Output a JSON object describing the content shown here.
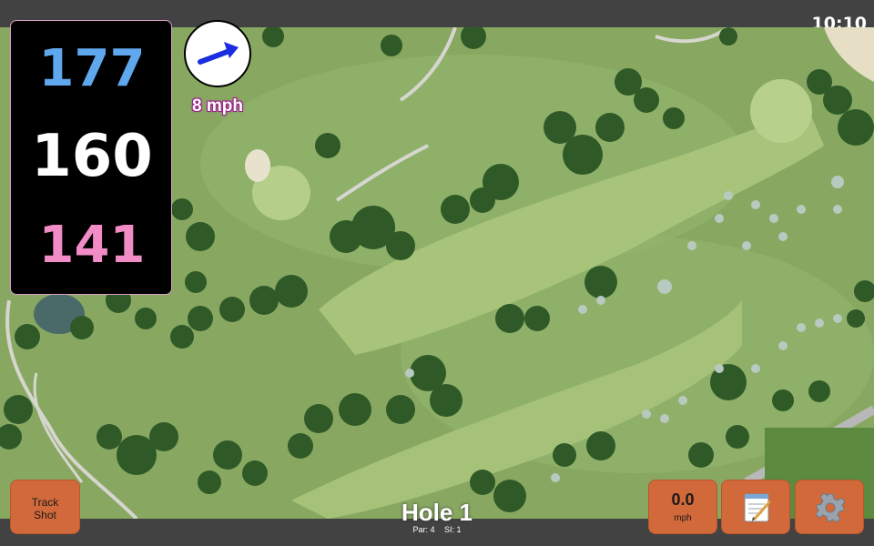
{
  "status": {
    "time": "10:10"
  },
  "distances": {
    "back": "177",
    "center": "160",
    "front": "141"
  },
  "wind": {
    "speed_label": "8 mph",
    "direction_icon": "arrow-icon"
  },
  "hole": {
    "title": "Hole 1",
    "par_label": "Par: 4",
    "stroke_index_label": "SI: 1"
  },
  "buttons": {
    "track_shot_line1": "Track",
    "track_shot_line2": "Shot",
    "speed_value": "0.0",
    "speed_unit": "mph",
    "notes_icon": "notepad-icon",
    "settings_icon": "gear-icon"
  },
  "colors": {
    "back_distance": "#5fa8ee",
    "center_distance": "#ffffff",
    "front_distance": "#f28cc6",
    "button_bg": "#d2693a",
    "bar_bg": "#424242"
  }
}
